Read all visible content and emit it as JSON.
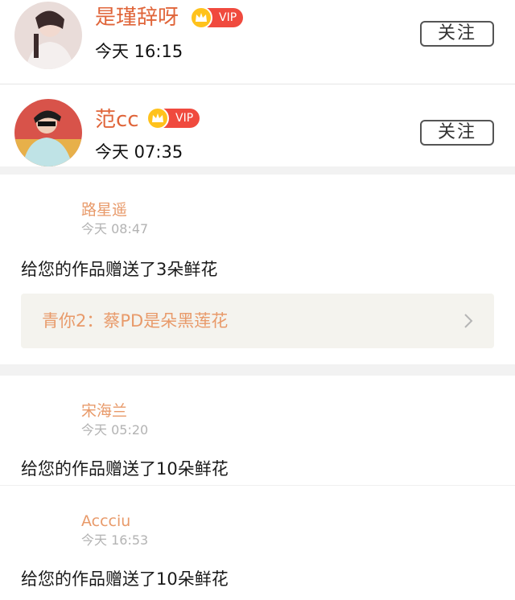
{
  "follow_list": [
    {
      "name": "是瑾辞呀",
      "vip": "VIP",
      "time": "今天 16:15",
      "button": "关注"
    },
    {
      "name": "范cc",
      "vip": "VIP",
      "time": "今天 07:35",
      "button": "关注"
    }
  ],
  "gifts": [
    {
      "sender": "路星遥",
      "time": "今天 08:47",
      "message": "给您的作品赠送了3朵鲜花",
      "work": "青你2：蔡PD是朵黑莲花"
    },
    {
      "sender": "宋海兰",
      "time": "今天 05:20",
      "message": "给您的作品赠送了10朵鲜花"
    },
    {
      "sender": "Accciu",
      "time": "今天 16:53",
      "message": "给您的作品赠送了10朵鲜花"
    }
  ],
  "colors": {
    "accent": "#e0653a",
    "vip": "#f04a3e",
    "crown": "#ffc21c",
    "sender": "#e89a6a"
  },
  "icons": [
    "crown-icon",
    "chevron-right-icon"
  ]
}
